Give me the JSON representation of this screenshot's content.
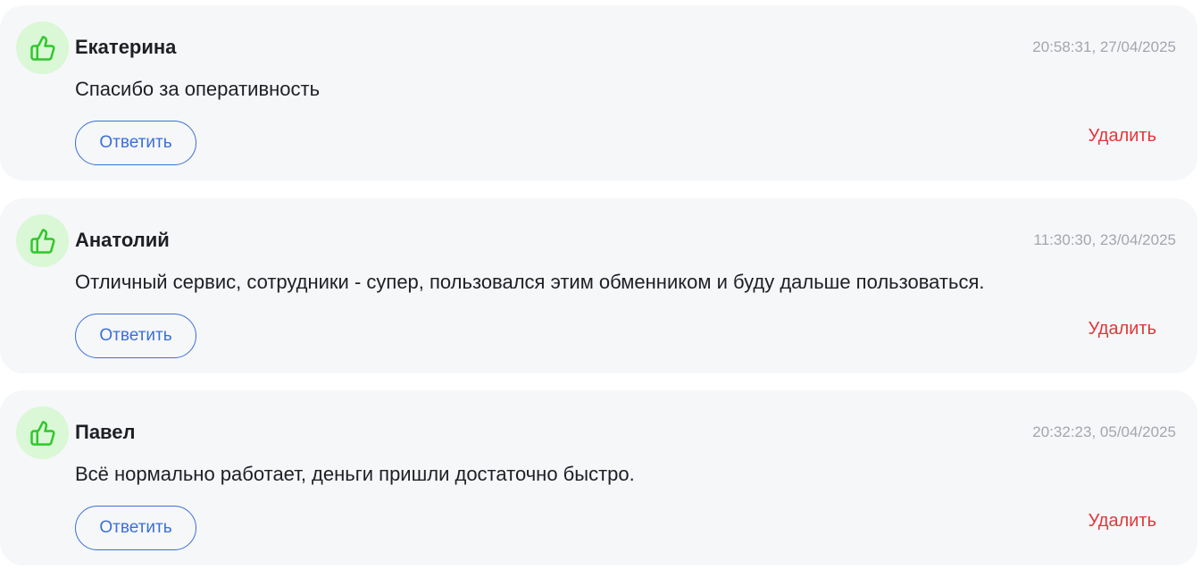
{
  "reviews": [
    {
      "author": "Екатерина",
      "timestamp": "20:58:31, 27/04/2025",
      "text": "Спасибо за оперативность",
      "reply_label": "Ответить",
      "delete_label": "Удалить",
      "icon": "thumbs-up-icon"
    },
    {
      "author": "Анатолий",
      "timestamp": "11:30:30, 23/04/2025",
      "text": "Отличный сервис, сотрудники - супер, пользовался этим обменником и буду дальше пользоваться.",
      "reply_label": "Ответить",
      "delete_label": "Удалить",
      "icon": "thumbs-up-icon"
    },
    {
      "author": "Павел",
      "timestamp": "20:32:23, 05/04/2025",
      "text": "Всё нормально работает, деньги пришли достаточно быстро.",
      "reply_label": "Ответить",
      "delete_label": "Удалить",
      "icon": "thumbs-up-icon"
    }
  ],
  "colors": {
    "card_background": "#f6f7f9",
    "avatar_background": "#daf7d6",
    "icon_green": "#2fc72a",
    "reply_blue": "#3a6fd9",
    "delete_red": "#e2373b",
    "timestamp_gray": "#a3a6ad",
    "text_dark": "#1d1f24"
  }
}
